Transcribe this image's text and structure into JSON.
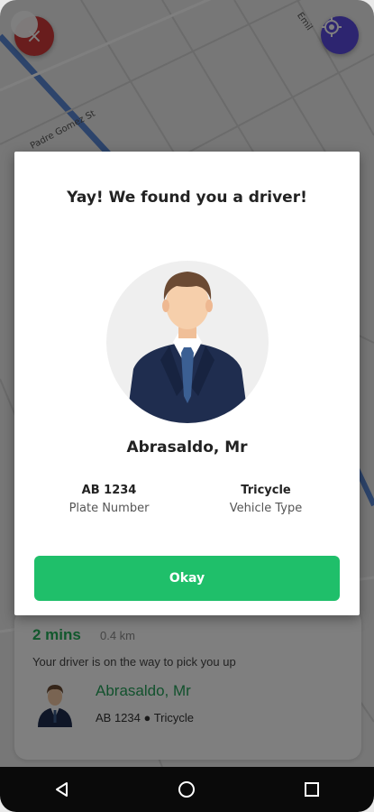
{
  "map": {
    "street_1": "Padre Gomez St",
    "street_2": "Emil"
  },
  "dialog": {
    "title": "Yay! We found you a driver!",
    "driver_name": "Abrasaldo, Mr",
    "plate_value": "AB 1234",
    "plate_label": "Plate Number",
    "vehicle_value": "Tricycle",
    "vehicle_label": "Vehicle Type",
    "okay_label": "Okay"
  },
  "sheet": {
    "eta": "2 mins",
    "distance": "0.4 km",
    "message": "Your driver is on the way to pick you up",
    "driver_name": "Abrasaldo, Mr",
    "details": "AB 1234 ● Tricycle"
  },
  "icons": {
    "close": "close-icon",
    "locate": "locate-icon",
    "back": "back-icon",
    "home": "home-icon",
    "recents": "recents-icon"
  },
  "colors": {
    "accent_green": "#1fbf6a",
    "close_red": "#d23a3a",
    "locate_purple": "#5b4ae0"
  }
}
